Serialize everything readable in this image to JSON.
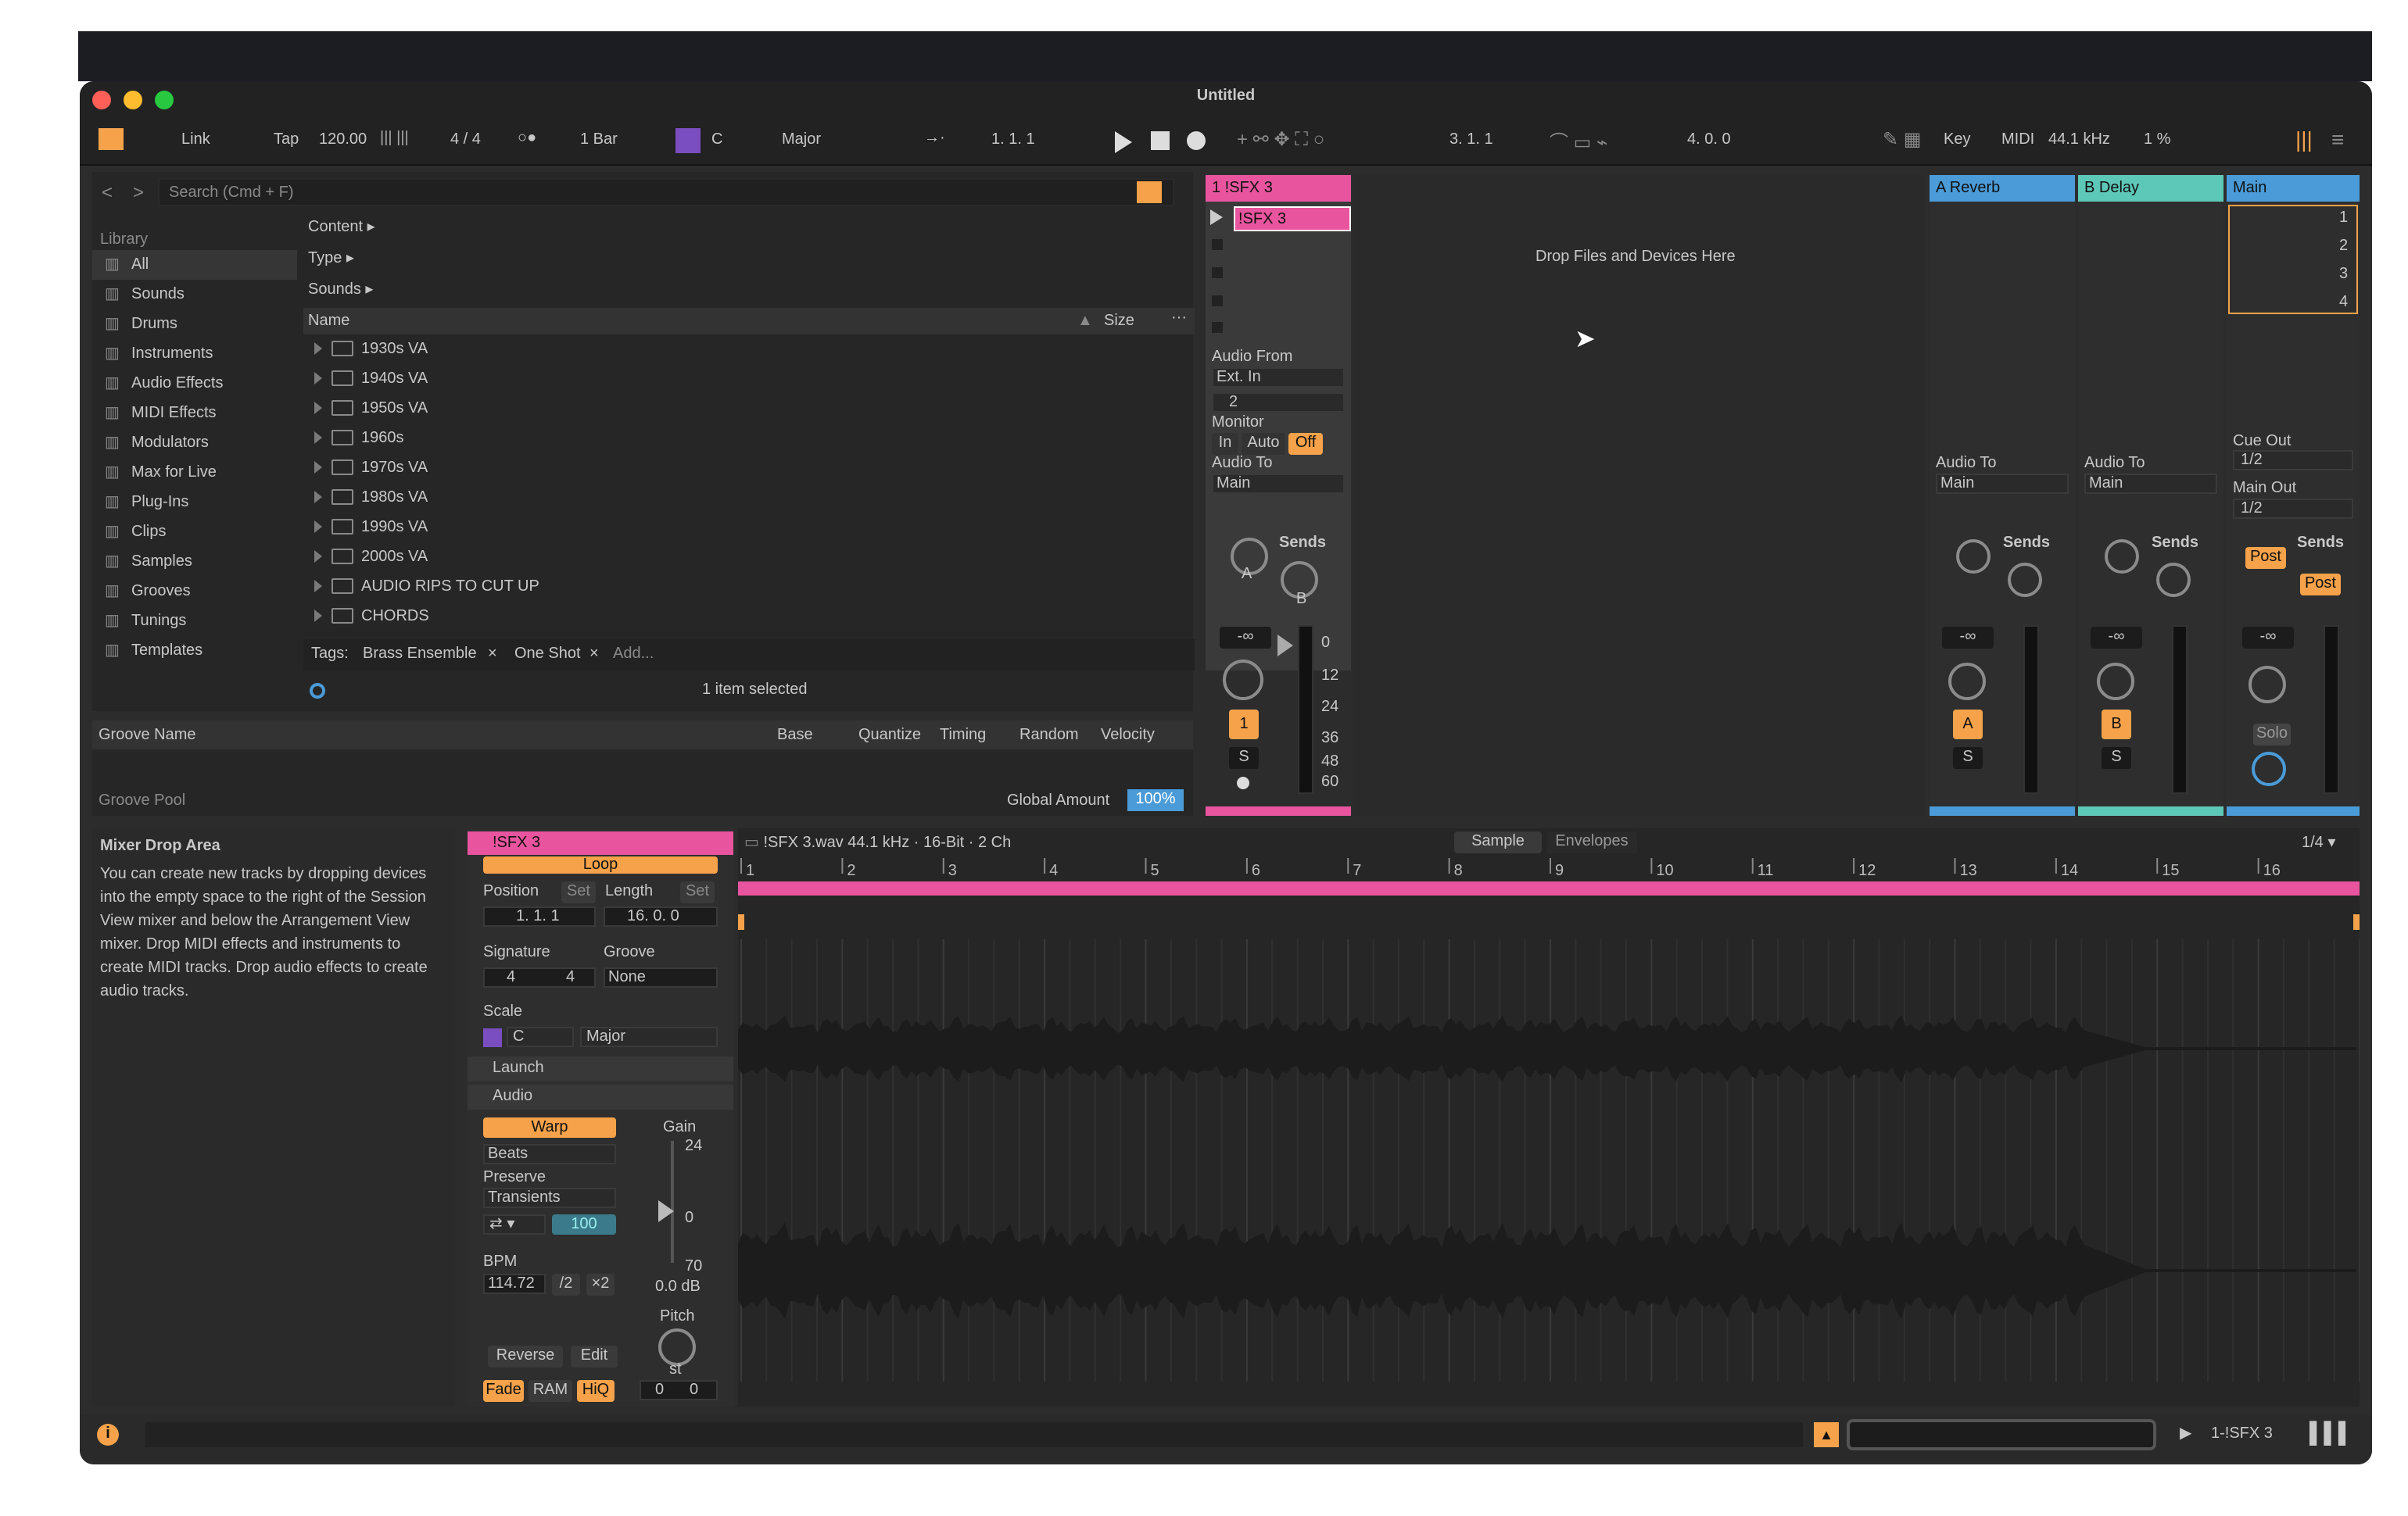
{
  "window": {
    "title": "Untitled"
  },
  "control_bar": {
    "link": "Link",
    "tap": "Tap",
    "tempo": "120.00",
    "signature": "4 / 4",
    "metro": "○●",
    "quantize": "1 Bar",
    "key": "C",
    "scale": "Major",
    "position": "1.  1.  1",
    "loop_start": "3.  1.  1",
    "loop_length": "4.  0.  0",
    "key_btn": "Key",
    "midi_btn": "MIDI",
    "sample_rate": "44.1 kHz",
    "cpu": "1 %"
  },
  "browser": {
    "search_placeholder": "Search (Cmd + F)",
    "library_label": "Library",
    "categories": [
      "All",
      "Sounds",
      "Drums",
      "Instruments",
      "Audio Effects",
      "MIDI Effects",
      "Modulators",
      "Max for Live",
      "Plug-Ins",
      "Clips",
      "Samples",
      "Grooves",
      "Tunings",
      "Templates"
    ],
    "filters": [
      "Content ▸",
      "Type ▸",
      "Sounds ▸"
    ],
    "col_name": "Name",
    "col_size": "Size",
    "items": [
      "1930s VA",
      "1940s VA",
      "1950s VA",
      "1960s",
      "1970s VA",
      "1980s VA",
      "1990s VA",
      "2000s VA",
      "AUDIO RIPS TO CUT UP",
      "CHORDS"
    ],
    "tags_label": "Tags:",
    "tags": [
      "Brass Ensemble",
      "One Shot"
    ],
    "tags_add": "Add...",
    "status": "1 item selected"
  },
  "groove": {
    "cols": [
      "Groove Name",
      "Base",
      "Quantize",
      "Timing",
      "Random",
      "Velocity"
    ],
    "pool": "Groove Pool",
    "global_amount_label": "Global Amount",
    "global_amount": "100%"
  },
  "session": {
    "track1": "1 !SFX 3",
    "clip": "!SFX 3",
    "drop_text": "Drop Files and Devices Here",
    "return_a": "A Reverb",
    "return_b": "B Delay",
    "main": "Main",
    "scenes": [
      "1",
      "2",
      "3",
      "4"
    ],
    "audio_from": "Audio From",
    "ext_in": "Ext. In",
    "input_ch": "2",
    "monitor": "Monitor",
    "mon_in": "In",
    "mon_auto": "Auto",
    "mon_off": "Off",
    "audio_to": "Audio To",
    "main_dest": "Main",
    "cue_out": "Cue Out",
    "cue_val": "1/2",
    "main_out": "Main Out",
    "main_val": "1/2",
    "sends": "Sends",
    "send_a": "A",
    "send_b": "B",
    "post": "Post",
    "vol_inf": "-∞",
    "db_marks": [
      "0",
      "12",
      "24",
      "36",
      "48",
      "60"
    ],
    "track_num": "1",
    "solo": "S",
    "ret_a": "A",
    "ret_b": "B",
    "solo_main": "Solo"
  },
  "info": {
    "title": "Mixer Drop Area",
    "text": "You can create new tracks by dropping devices into the empty space to the right of the Session View mixer and below the Arrangement View mixer. Drop MIDI effects and instruments to create MIDI tracks. Drop audio effects to create audio tracks."
  },
  "clip": {
    "name": "!SFX 3",
    "loop": "Loop",
    "position_label": "Position",
    "set": "Set",
    "length_label": "Length",
    "pos_val": "1.  1.  1",
    "len_val": "16.  0.  0",
    "signature_label": "Signature",
    "groove_label": "Groove",
    "sig_num": "4",
    "sig_den": "4",
    "groove_val": "None",
    "scale_label": "Scale",
    "scale_key": "C",
    "scale_mode": "Major",
    "launch": "Launch",
    "audio": "Audio",
    "warp": "Warp",
    "warp_mode": "Beats",
    "preserve": "Preserve",
    "transients": "Transients",
    "amount": "100",
    "bpm_label": "BPM",
    "bpm": "114.72",
    "half": "/2",
    "double": "×2",
    "gain_label": "Gain",
    "gain_24": "24",
    "gain_0": "0",
    "gain_70": "70",
    "gain_db": "0.0 dB",
    "pitch_label": "Pitch",
    "st": "st",
    "reverse": "Reverse",
    "edit": "Edit",
    "fade": "Fade",
    "ram": "RAM",
    "hiq": "HiQ",
    "pitch_a": "0",
    "pitch_b": "0"
  },
  "sample": {
    "file": "!SFX 3.wav  44.1 kHz · 16-Bit · 2 Ch",
    "tab_sample": "Sample",
    "tab_env": "Envelopes",
    "grid": "1/4 ▾",
    "bars": [
      "1",
      "2",
      "3",
      "4",
      "5",
      "6",
      "7",
      "8",
      "9",
      "10",
      "11",
      "12",
      "13",
      "14",
      "15",
      "16"
    ]
  },
  "status": {
    "track": "1-!SFX 3"
  },
  "colors": {
    "accent": "#f5a24a",
    "pink": "#e8559e",
    "blue": "#4a9bd8",
    "teal": "#5ec8b8"
  }
}
